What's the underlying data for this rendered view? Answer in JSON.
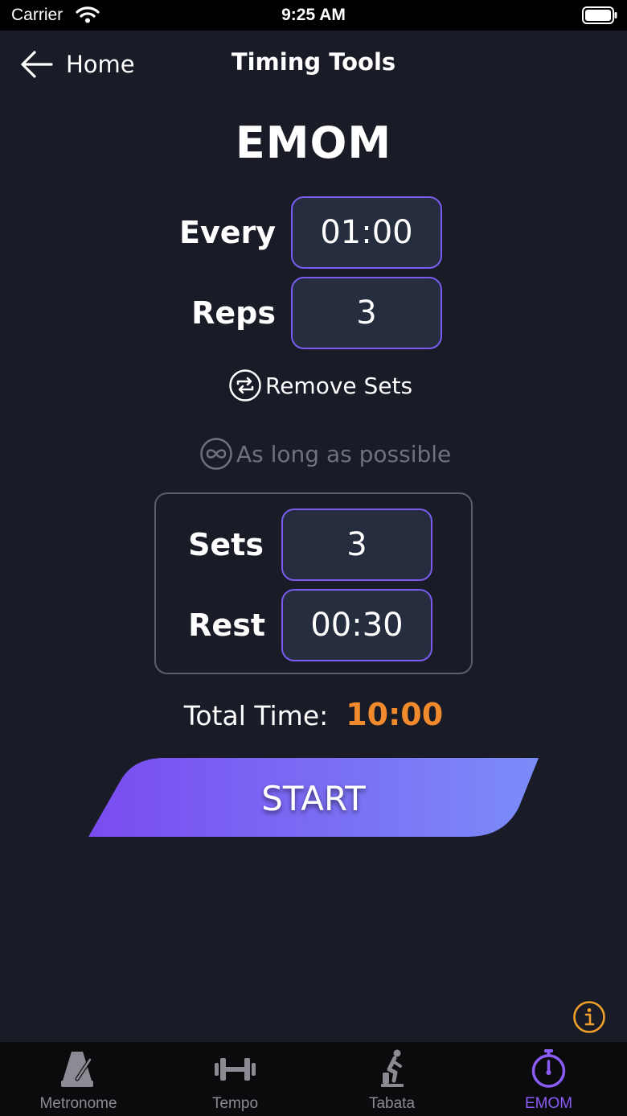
{
  "status_bar": {
    "carrier": "Carrier",
    "time": "9:25 AM"
  },
  "nav": {
    "back_label": "Home",
    "title": "Timing Tools"
  },
  "page_title": "EMOM",
  "every": {
    "label": "Every",
    "value": "01:00"
  },
  "reps": {
    "label": "Reps",
    "value": "3"
  },
  "remove_sets": {
    "label": "Remove Sets",
    "icon": "repeat-icon"
  },
  "infinite": {
    "label": "As long as possible",
    "icon": "infinity-icon"
  },
  "sets": {
    "label": "Sets",
    "value": "3"
  },
  "rest": {
    "label": "Rest",
    "value": "00:30"
  },
  "total_time": {
    "label": "Total Time:",
    "value": "10:00"
  },
  "start_button": {
    "label": "START"
  },
  "colors": {
    "background": "#191b26",
    "accent": "#7b5cf0",
    "total_time": "#f08a2c",
    "tab_active": "#8c5cf6",
    "tab_inactive": "#8a8b93",
    "start_gradient": [
      "#7a4cf0",
      "#7b8cf8"
    ]
  },
  "tabs": [
    {
      "label": "Metronome",
      "icon": "metronome-icon",
      "active": false
    },
    {
      "label": "Tempo",
      "icon": "dumbbell-icon",
      "active": false
    },
    {
      "label": "Tabata",
      "icon": "exercise-bike-icon",
      "active": false
    },
    {
      "label": "EMOM",
      "icon": "stopwatch-icon",
      "active": true
    }
  ]
}
